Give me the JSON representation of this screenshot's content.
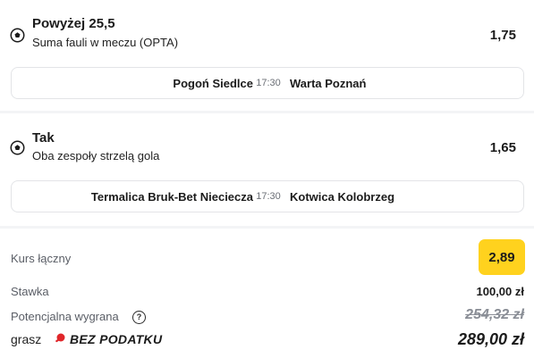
{
  "bets": [
    {
      "pick": "Powyżej 25,5",
      "market": "Suma fauli w meczu (OPTA)",
      "odds": "1,75",
      "home": "Pogoń Siedlce",
      "time": "17:30",
      "away": "Warta Poznań"
    },
    {
      "pick": "Tak",
      "market": "Oba zespoły strzelą gola",
      "odds": "1,65",
      "home": "Termalica Bruk-Bet Nieciecza",
      "time": "17:30",
      "away": "Kotwica Kolobrzeg"
    }
  ],
  "summary": {
    "total_odds_label": "Kurs łączny",
    "total_odds": "2,89",
    "stake_label": "Stawka",
    "stake": "100,00 zł",
    "potential_win_label": "Potencjalna wygrana",
    "potential_win_old": "254,32 zł",
    "promo_prefix": "grasz",
    "promo_badge": "BEZ PODATKU",
    "potential_win_final": "289,00 zł"
  },
  "colors": {
    "accent_yellow": "#ffd21e",
    "promo_red": "#e0262a"
  },
  "icons": {
    "sport": "football-icon",
    "help": "question-icon",
    "promo": "ping-pong-logo-icon"
  }
}
